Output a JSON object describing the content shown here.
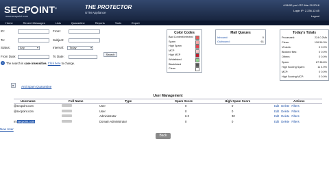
{
  "header": {
    "logo_text_1": "SECP",
    "logo_text_2": "INT",
    "logo_reg": "®",
    "logo_url": "www.secpoint.com",
    "app_name": "THE PROTECTOR",
    "app_sub": "UTM Appliance",
    "datetime": "4:56:52 pm UTC Mar 29 2018",
    "login_ip": "Login IP: 2.236.12.65",
    "logout": "Logout"
  },
  "nav": [
    "Home",
    "Recent Messages",
    "Lists",
    "Quarantine",
    "Reports",
    "Tools",
    "Export"
  ],
  "search": {
    "id_label": "ID:",
    "from_label": "From:",
    "to_label": "To:",
    "subject_label": "Subject:",
    "status_label": "Status:",
    "status_value": "Any",
    "interval_label": "Interval:",
    "interval_value": "Today",
    "from_date_label": "From Date:",
    "to_date_label": "To Date:",
    "search_button": "Search",
    "note_prefix": "The search is",
    "note_bold": "case insensitive.",
    "note_link": "Click here",
    "note_suffix": "to change."
  },
  "color_codes": {
    "title": "Color Codes",
    "items": [
      {
        "label": "Bad Content/Infected",
        "color": "#e35b5b"
      },
      {
        "label": "Spam",
        "color": "#f2a5a5"
      },
      {
        "label": "High Spam",
        "color": "#e8434f"
      },
      {
        "label": "MCP",
        "color": "#f5c9c9"
      },
      {
        "label": "High MCP",
        "color": "#c01a2a"
      },
      {
        "label": "Whitelisted",
        "color": "#8fd48f"
      },
      {
        "label": "Blacklisted",
        "color": "#555555"
      },
      {
        "label": "Clean",
        "color": "#ffffff"
      }
    ]
  },
  "mail_queues": {
    "title": "Mail Queues",
    "inbound_label": "Inbound:",
    "inbound_value": "0",
    "outbound_label": "Outbound:",
    "outbound_value": "61"
  },
  "totals": {
    "title": "Today's Totals",
    "rows": [
      {
        "label": "Processed:",
        "value": "224  0.2Mb"
      },
      {
        "label": "Clean:",
        "value": "126  56.3%"
      },
      {
        "label": "Viruses:",
        "value": "0  0.0%"
      },
      {
        "label": "Blocked files:",
        "value": "0  0.0%"
      },
      {
        "label": "Others:",
        "value": "0  0.0%"
      },
      {
        "label": "Spam:",
        "value": "87  38.8%"
      },
      {
        "label": "High Scoring Spam:",
        "value": "11  4.9%"
      },
      {
        "label": "MCP:",
        "value": "0  0.0%"
      },
      {
        "label": "High Scoring MCP:",
        "value": "0  0.0%"
      }
    ]
  },
  "quarantine_link": "Anti Spam Quarantine",
  "user_management": {
    "title": "User Management",
    "columns": [
      "Username",
      "Full Name",
      "Type",
      "Spam Score",
      "High Spam Score",
      "Actions"
    ],
    "rows": [
      {
        "username": "@secpoint.com",
        "fullname": "",
        "type": "User",
        "spam": "0",
        "high": "0"
      },
      {
        "username": "@secpoint.com",
        "fullname": "",
        "type": "User",
        "spam": "0",
        "high": "0"
      },
      {
        "username": "",
        "fullname": "",
        "type": "Administrator",
        "spam": "6.3",
        "high": "30"
      },
      {
        "username": "Int",
        "username_sel": "secpoint.com",
        "fullname": "",
        "type": "Domain Administrator",
        "spam": "0",
        "high": "0"
      }
    ],
    "actions": [
      "Edit",
      "Delete",
      "Filters"
    ],
    "new_user": "New User"
  },
  "back_button": "Back"
}
